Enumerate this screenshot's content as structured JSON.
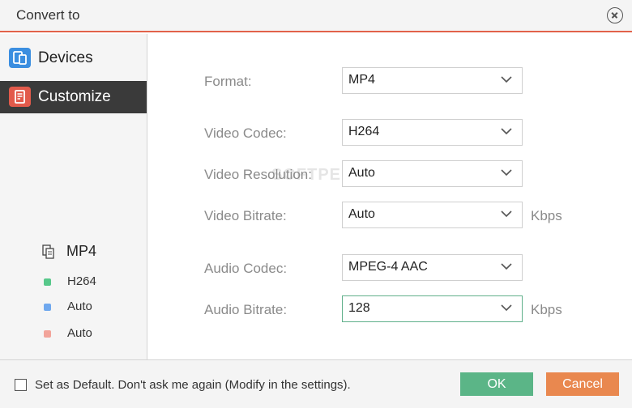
{
  "window": {
    "title": "Convert to"
  },
  "sidebar": {
    "items": [
      {
        "label": "Devices",
        "icon": "device-icon",
        "selected": false
      },
      {
        "label": "Customize",
        "icon": "customize-icon",
        "selected": true
      }
    ],
    "summary": {
      "format": "MP4",
      "video_codec": "H264",
      "video_resolution": "Auto",
      "video_bitrate": "Auto",
      "colors": {
        "video_codec": "#57c88a",
        "video_resolution": "#6fa8ee",
        "video_bitrate": "#f2a49a"
      }
    }
  },
  "form": {
    "format": {
      "label": "Format:",
      "value": "MP4"
    },
    "video_codec": {
      "label": "Video Codec:",
      "value": "H264"
    },
    "video_resolution": {
      "label": "Video Resolution:",
      "value": "Auto"
    },
    "video_bitrate": {
      "label": "Video Bitrate:",
      "value": "Auto",
      "unit": "Kbps"
    },
    "audio_codec": {
      "label": "Audio Codec:",
      "value": "MPEG-4 AAC"
    },
    "audio_bitrate": {
      "label": "Audio Bitrate:",
      "value": "128",
      "unit": "Kbps"
    }
  },
  "watermark": "SOFTPEDIA",
  "footer": {
    "checkbox_label": "Set as Default. Don't ask me again (Modify in the settings).",
    "checked": false,
    "ok_label": "OK",
    "cancel_label": "Cancel"
  },
  "colors": {
    "accent": "#e2624a",
    "ok": "#5bb587",
    "cancel": "#e9884f",
    "selected_bg": "#3a3a3a"
  }
}
